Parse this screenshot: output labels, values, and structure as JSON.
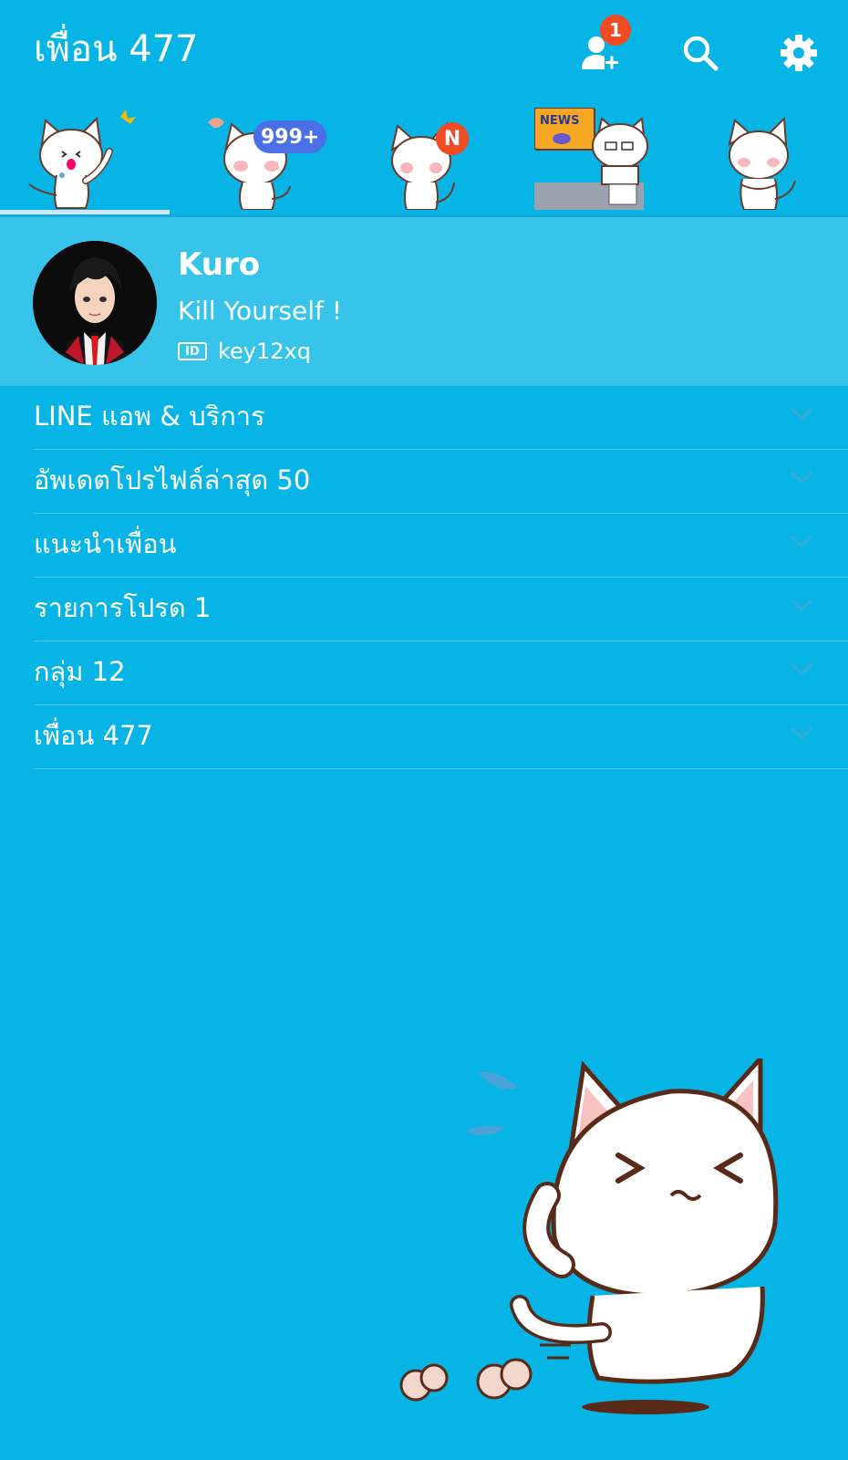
{
  "header": {
    "title": "เพื่อน 477",
    "add_friend_badge": "1",
    "icons": [
      "add-friend-icon",
      "search-icon",
      "settings-icon"
    ]
  },
  "tabs": [
    {
      "name": "friends",
      "badge": ""
    },
    {
      "name": "chats",
      "badge": "999+"
    },
    {
      "name": "timeline",
      "badge": "N"
    },
    {
      "name": "news",
      "badge": ""
    },
    {
      "name": "more",
      "badge": ""
    }
  ],
  "profile": {
    "name": "Kuro",
    "status": "Kill Yourself !",
    "id_label": "ID",
    "id": "key12xq"
  },
  "sections": [
    {
      "label": "LINE แอพ & บริการ"
    },
    {
      "label": "อัพเดตโปรไฟล์ล่าสุด 50"
    },
    {
      "label": "แนะนำเพื่อน"
    },
    {
      "label": "รายการโปรด 1"
    },
    {
      "label": "กลุ่ม 12"
    },
    {
      "label": "เพื่อน 477"
    }
  ],
  "colors": {
    "background": "#06b4e6",
    "profile_bg": "#37c4ea",
    "badge_red": "#f04b22",
    "badge_blue": "#4a6fe6",
    "tab_indicator": "#cfe7ff"
  }
}
